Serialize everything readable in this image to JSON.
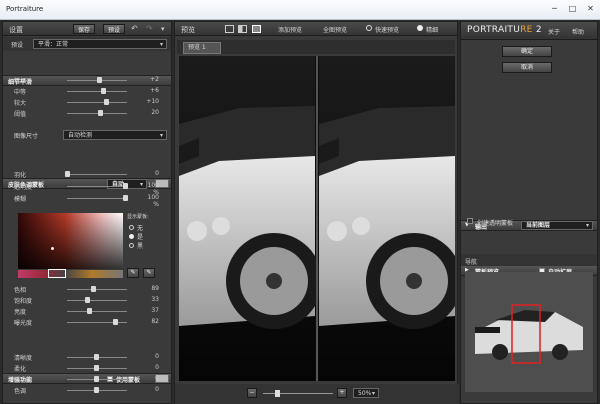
{
  "app": {
    "title": "Portraiture"
  },
  "left": {
    "header": "设置",
    "save": "保存",
    "preset_btn": "预设",
    "preset_label": "预设",
    "preset_value": "平滑：正常",
    "detail_title": "细节平滑",
    "sliders": [
      {
        "label": "精细",
        "value": "+2",
        "pos": 0.55
      },
      {
        "label": "中等",
        "value": "+6",
        "pos": 0.62
      },
      {
        "label": "较大",
        "value": "+10",
        "pos": 0.68
      },
      {
        "label": "阈值",
        "value": "20",
        "pos": 0.57
      }
    ],
    "portrait_size_label": "图像尺寸",
    "portrait_size_value": "自动检测",
    "skin_title": "皮肤色调蒙板",
    "skin_mode": "自动",
    "skin_sliders": [
      {
        "label": "羽化",
        "value": "0",
        "unit": "",
        "pos": 0.0
      },
      {
        "label": "透明度",
        "value": "100",
        "unit": "%",
        "pos": 1.0
      },
      {
        "label": "模糊",
        "value": "100",
        "unit": "%",
        "pos": 1.0
      }
    ],
    "mask_label": "显示蒙板:",
    "mask_options": [
      "无",
      "是",
      "黑"
    ],
    "color_sliders": [
      {
        "label": "色相",
        "value": "89",
        "pos": 0.45
      },
      {
        "label": "饱和度",
        "value": "33",
        "pos": 0.35
      },
      {
        "label": "亮度",
        "value": "37",
        "pos": 0.38
      },
      {
        "label": "曝光度",
        "value": "82",
        "pos": 0.82
      }
    ],
    "enhance_title": "增强功能",
    "enhance_mask": "使用蒙板",
    "enhance_sliders": [
      {
        "label": "清晰度",
        "value": "0",
        "pos": 0.5
      },
      {
        "label": "柔化",
        "value": "0",
        "pos": 0.5
      },
      {
        "label": "暖色调",
        "value": "0",
        "pos": 0.5
      },
      {
        "label": "色调",
        "value": "0",
        "pos": 0.5
      }
    ]
  },
  "center": {
    "header": "预览",
    "add_preview": "添加预览",
    "full_preview": "全图预览",
    "quick_preview": "快速预览",
    "fine": "精细",
    "tab": "预览 1",
    "zoom": "50%"
  },
  "right": {
    "brand_left": "PORTRAITU",
    "brand_mid": "RE",
    "brand_num": "2",
    "about": "关于",
    "help": "帮助",
    "ok": "确定",
    "cancel": "取消",
    "output": "输出",
    "output_value": "当前图层",
    "new_layer": "创建透明蒙板",
    "mask_preview": "蒙板预览",
    "auto_expand": "自动扩展",
    "navigator": "导航"
  },
  "colors": {
    "accent": "#f0a030",
    "nav_box": "#e02020",
    "mask_pink": "#c23a6a"
  }
}
